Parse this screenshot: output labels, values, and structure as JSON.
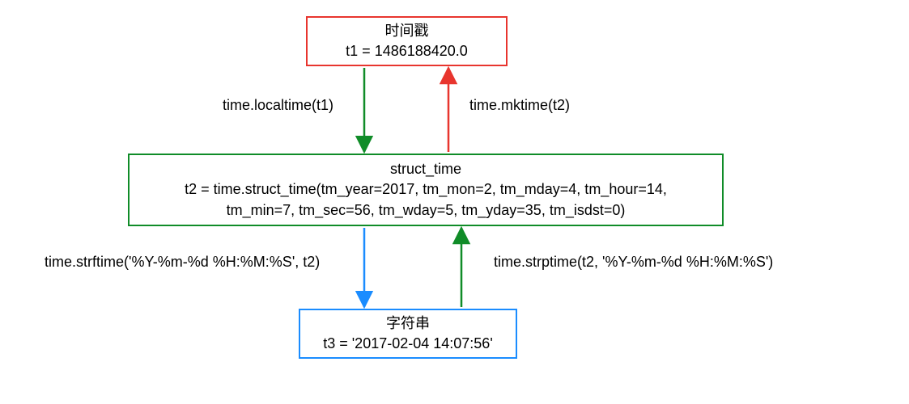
{
  "boxes": {
    "timestamp": {
      "title": "时间戳",
      "value": "t1 = 1486188420.0",
      "color": "#e8352e"
    },
    "struct_time": {
      "title": "struct_time",
      "value_line1": "t2 = time.struct_time(tm_year=2017, tm_mon=2, tm_mday=4, tm_hour=14,",
      "value_line2": "tm_min=7, tm_sec=56, tm_wday=5, tm_yday=35, tm_isdst=0)",
      "color": "#108c28"
    },
    "string": {
      "title": "字符串",
      "value": "t3 = '2017-02-04 14:07:56'",
      "color": "#1a8cff"
    }
  },
  "arrows": {
    "localtime": {
      "label": "time.localtime(t1)",
      "color": "#108c28"
    },
    "mktime": {
      "label": "time.mktime(t2)",
      "color": "#e8352e"
    },
    "strftime": {
      "label": "time.strftime('%Y-%m-%d %H:%M:%S', t2)",
      "color": "#1a8cff"
    },
    "strptime": {
      "label": "time.strptime(t2, '%Y-%m-%d %H:%M:%S')",
      "color": "#108c28"
    }
  }
}
